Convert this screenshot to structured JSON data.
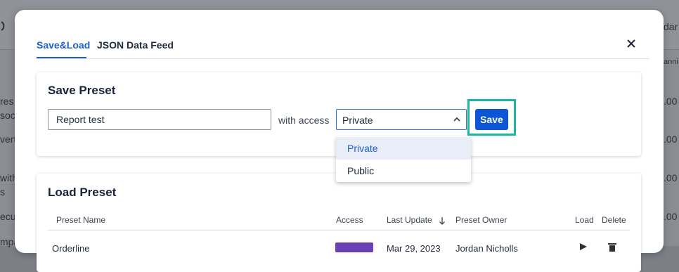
{
  "background": {
    "top_right_text": "dar",
    "top_left_icon": "refresh-icon",
    "header_right_text": "anni",
    "left_fragments": [
      "res",
      "soc",
      "vert",
      "with",
      "s",
      "ecut",
      "mpa"
    ],
    "right_values": [
      ".00",
      ".00",
      ".00",
      ".00",
      ".00",
      ".00"
    ]
  },
  "modal": {
    "tabs": [
      {
        "label": "Save&Load",
        "active": true
      },
      {
        "label": "JSON Data Feed",
        "active": false
      }
    ],
    "close_icon": "close-icon"
  },
  "save_preset": {
    "title": "Save Preset",
    "name_value": "Report test",
    "with_access_label": "with access",
    "access_value": "Private",
    "save_label": "Save",
    "options": [
      "Private",
      "Public"
    ]
  },
  "load_preset": {
    "title": "Load Preset",
    "columns": {
      "name": "Preset Name",
      "access": "Access",
      "last_update": "Last Update",
      "owner": "Preset Owner",
      "load": "Load",
      "delete": "Delete"
    },
    "rows": [
      {
        "name": "Orderline",
        "last_update": "Mar 29, 2023",
        "owner": "Jordan Nicholls"
      }
    ]
  },
  "colors": {
    "accent": "#1d5fd1",
    "save_button": "#0b55d6",
    "highlight": "#19b89c",
    "badge": "#6b3fb5"
  }
}
